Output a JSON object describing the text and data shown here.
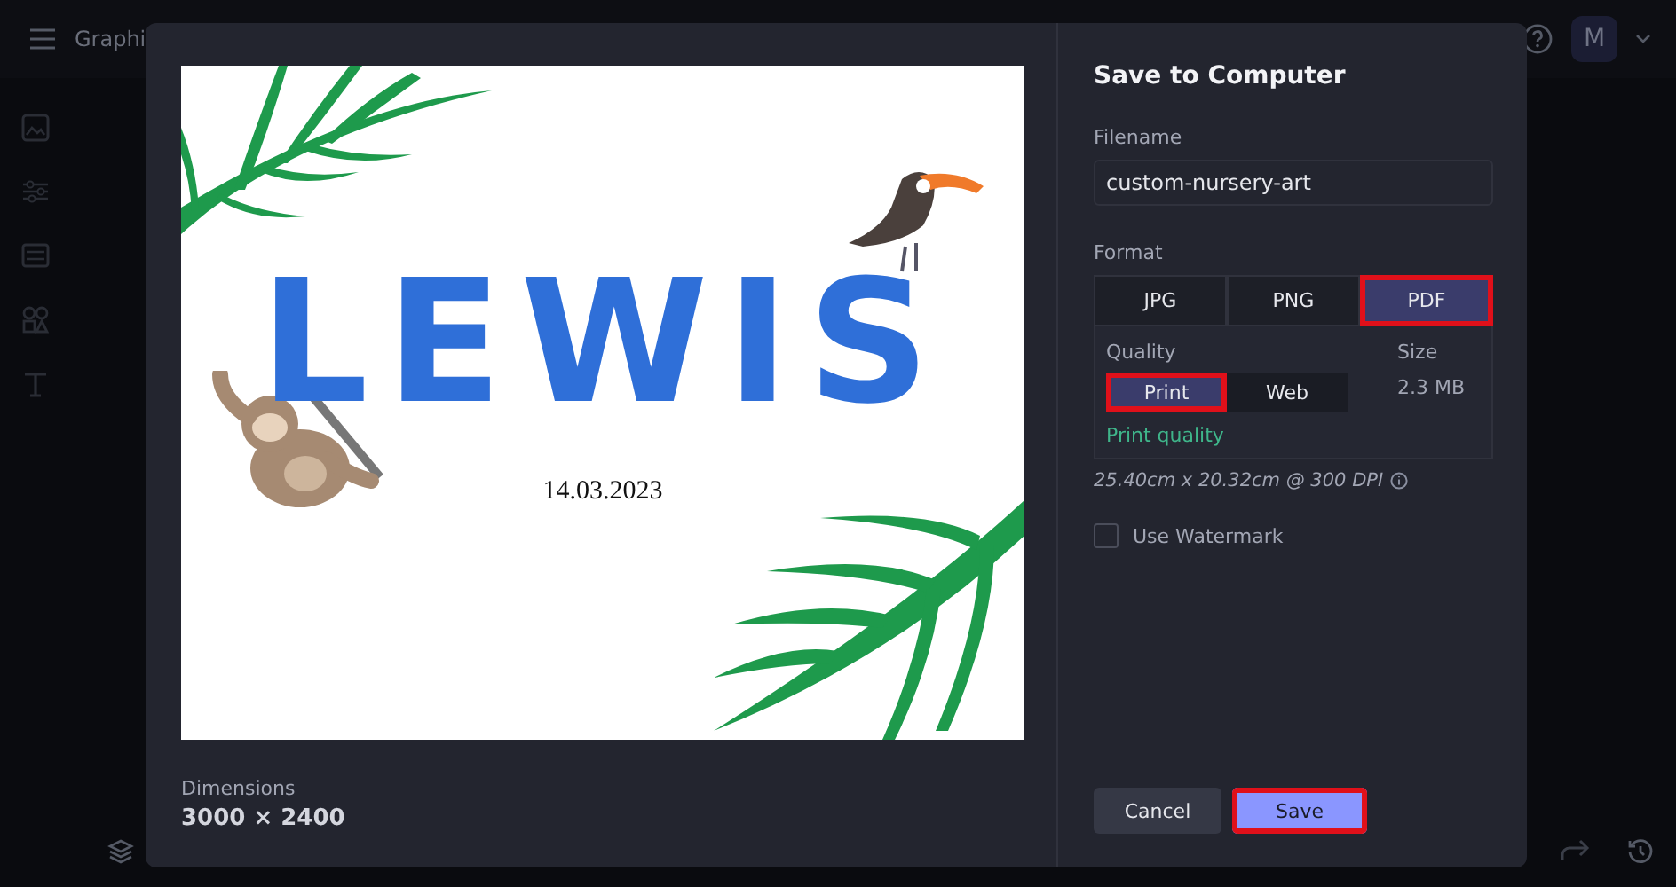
{
  "app": {
    "title": "Graphi",
    "avatar": "M"
  },
  "dialog": {
    "title": "Save to Computer",
    "preview": {
      "name": "LEWIS",
      "date": "14.03.2023"
    },
    "dimensions_label": "Dimensions",
    "dimensions": "3000 × 2400",
    "filename": {
      "label": "Filename",
      "value": "custom-nursery-art"
    },
    "format": {
      "label": "Format",
      "options": [
        {
          "label": "JPG",
          "selected": false,
          "highlighted": false
        },
        {
          "label": "PNG",
          "selected": false,
          "highlighted": false
        },
        {
          "label": "PDF",
          "selected": true,
          "highlighted": true
        }
      ]
    },
    "quality": {
      "label": "Quality",
      "options": [
        {
          "label": "Print",
          "selected": true,
          "highlighted": true
        },
        {
          "label": "Web",
          "selected": false,
          "highlighted": false
        }
      ],
      "note": "Print quality",
      "size_label": "Size",
      "size": "2.3 MB"
    },
    "print_size": "25.40cm x 20.32cm @ 300 DPI",
    "watermark": {
      "label": "Use Watermark",
      "checked": false
    },
    "buttons": [
      {
        "label": "Cancel",
        "kind": "secondary",
        "highlighted": false
      },
      {
        "label": "Save",
        "kind": "primary",
        "highlighted": true
      }
    ]
  }
}
